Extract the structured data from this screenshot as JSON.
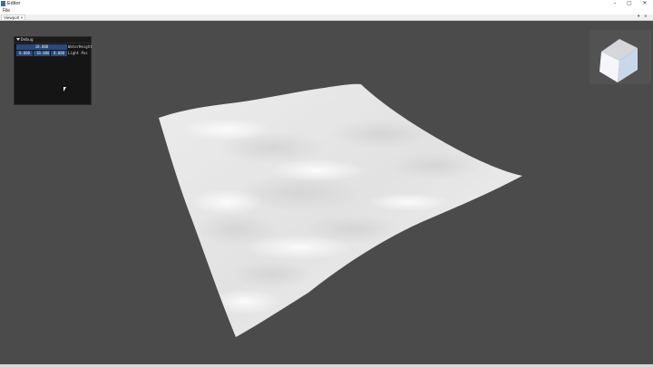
{
  "window": {
    "title": "Editor",
    "minimize_glyph": "–",
    "maximize_glyph": "▢",
    "close_glyph": "✕"
  },
  "menu": {
    "items": [
      {
        "label": "File"
      }
    ]
  },
  "tabs": [
    {
      "label": "Viewport",
      "close_glyph": "×"
    }
  ],
  "tab_controls": {
    "menu_glyph": "▾",
    "close_glyph": "×"
  },
  "debug_window": {
    "title": "Debug",
    "water_height": {
      "value": "10.000",
      "label": "WaterHeight"
    },
    "light_pos": {
      "values": [
        "0.000",
        "-10.000",
        "0.000"
      ],
      "label": "Light Pos"
    }
  },
  "viewport": {
    "background": "#4b4b4b",
    "terrain_color": "#f2f2f2",
    "gizmo_color": "#e6eaf0"
  },
  "icons": {
    "app": "app-icon",
    "cursor": "mouse-cursor-icon",
    "gizmo": "view-cube-gizmo"
  }
}
